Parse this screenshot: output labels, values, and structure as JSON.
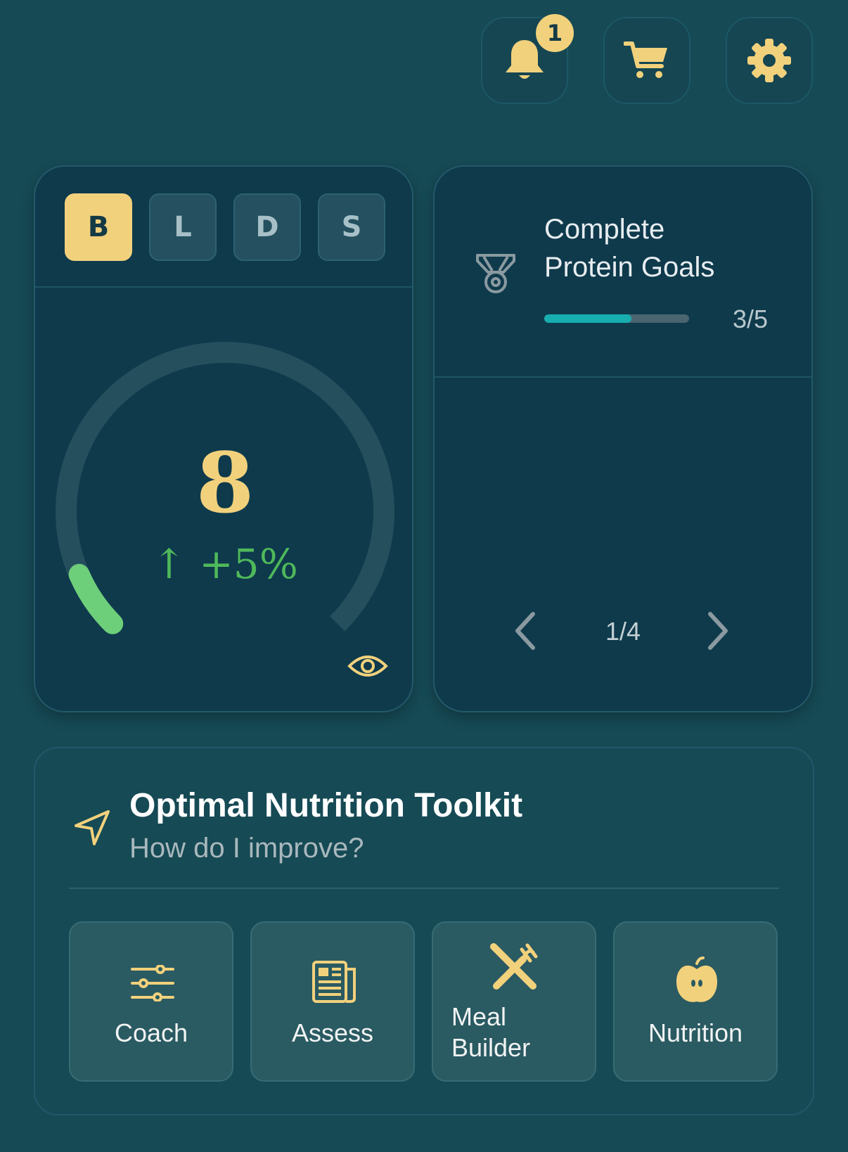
{
  "header": {
    "notifications": {
      "icon": "bell-icon",
      "badge_count": "1"
    },
    "cart": {
      "icon": "cart-icon"
    },
    "settings": {
      "icon": "gear-icon"
    }
  },
  "score_card": {
    "meal_tabs": [
      {
        "label": "B",
        "active": true
      },
      {
        "label": "L",
        "active": false
      },
      {
        "label": "D",
        "active": false
      },
      {
        "label": "S",
        "active": false
      }
    ],
    "score": "8",
    "change": "↑ +5%",
    "gauge_fraction": 0.08,
    "colors": {
      "gauge_fill": "#6ecf7a",
      "gauge_track": "#264f5e",
      "accent": "#f2d17c",
      "change": "#4fb85a"
    },
    "view_icon": "eye-icon"
  },
  "goal_card": {
    "icon": "medal-icon",
    "title_line1": "Complete",
    "title_line2": "Protein Goals",
    "progress_text": "3/5",
    "progress_fraction": 0.6,
    "pager": {
      "current": "1/4",
      "prev_icon": "chevron-left-icon",
      "next_icon": "chevron-right-icon"
    }
  },
  "toolkit": {
    "icon": "navigation-arrow-icon",
    "title": "Optimal Nutrition Toolkit",
    "subtitle": "How do I improve?",
    "tools": [
      {
        "label": "Coach",
        "icon": "sliders-icon"
      },
      {
        "label": "Assess",
        "icon": "newspaper-icon"
      },
      {
        "label_line1": "Meal",
        "label_line2": "Builder",
        "icon": "utensils-icon"
      },
      {
        "label": "Nutrition",
        "icon": "apple-icon"
      }
    ]
  }
}
